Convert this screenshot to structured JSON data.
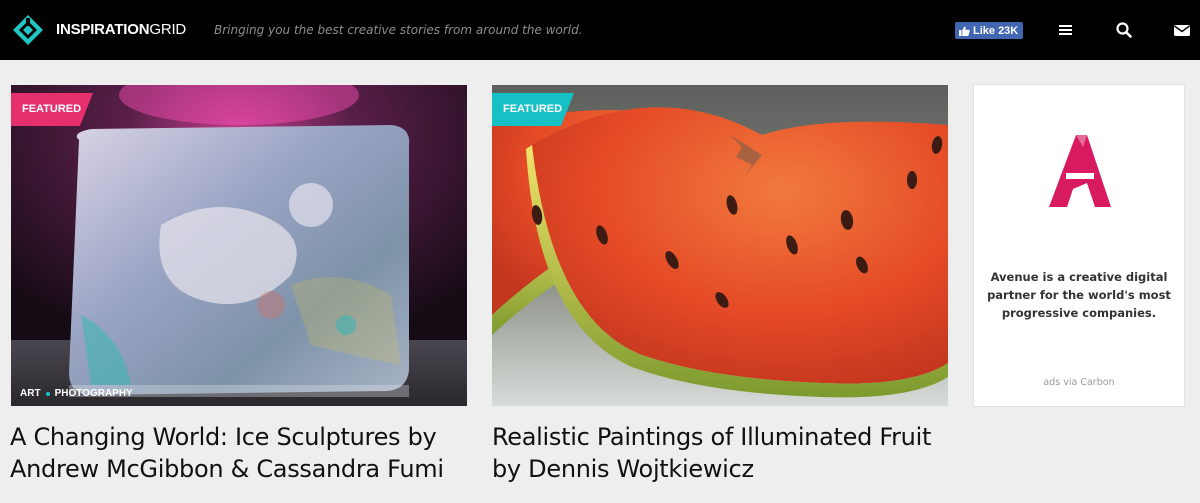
{
  "header": {
    "brand_bold": "INSPIRATION",
    "brand_light": "GRID",
    "tagline": "Bringing you the best creative stories from around the world.",
    "fb_like": "Like 23K",
    "icons": [
      "menu-icon",
      "search-icon",
      "mail-icon"
    ]
  },
  "posts": [
    {
      "badge": "FEATURED",
      "badge_color": "#e6306d",
      "categories": [
        "ART",
        "PHOTOGRAPHY"
      ],
      "title_line1": "A Changing World: Ice Sculptures by",
      "title_line2": "Andrew McGibbon & Cassandra Fumi"
    },
    {
      "badge": "FEATURED",
      "badge_color": "#16c1c5",
      "title_line1": "Realistic Paintings of Illuminated Fruit",
      "title_line2": "by Dennis Wojtkiewicz"
    }
  ],
  "ad": {
    "text": "Avenue is a creative digital partner for the world's most progressive companies.",
    "via": "ads via Carbon",
    "accent": "#d81b60"
  }
}
